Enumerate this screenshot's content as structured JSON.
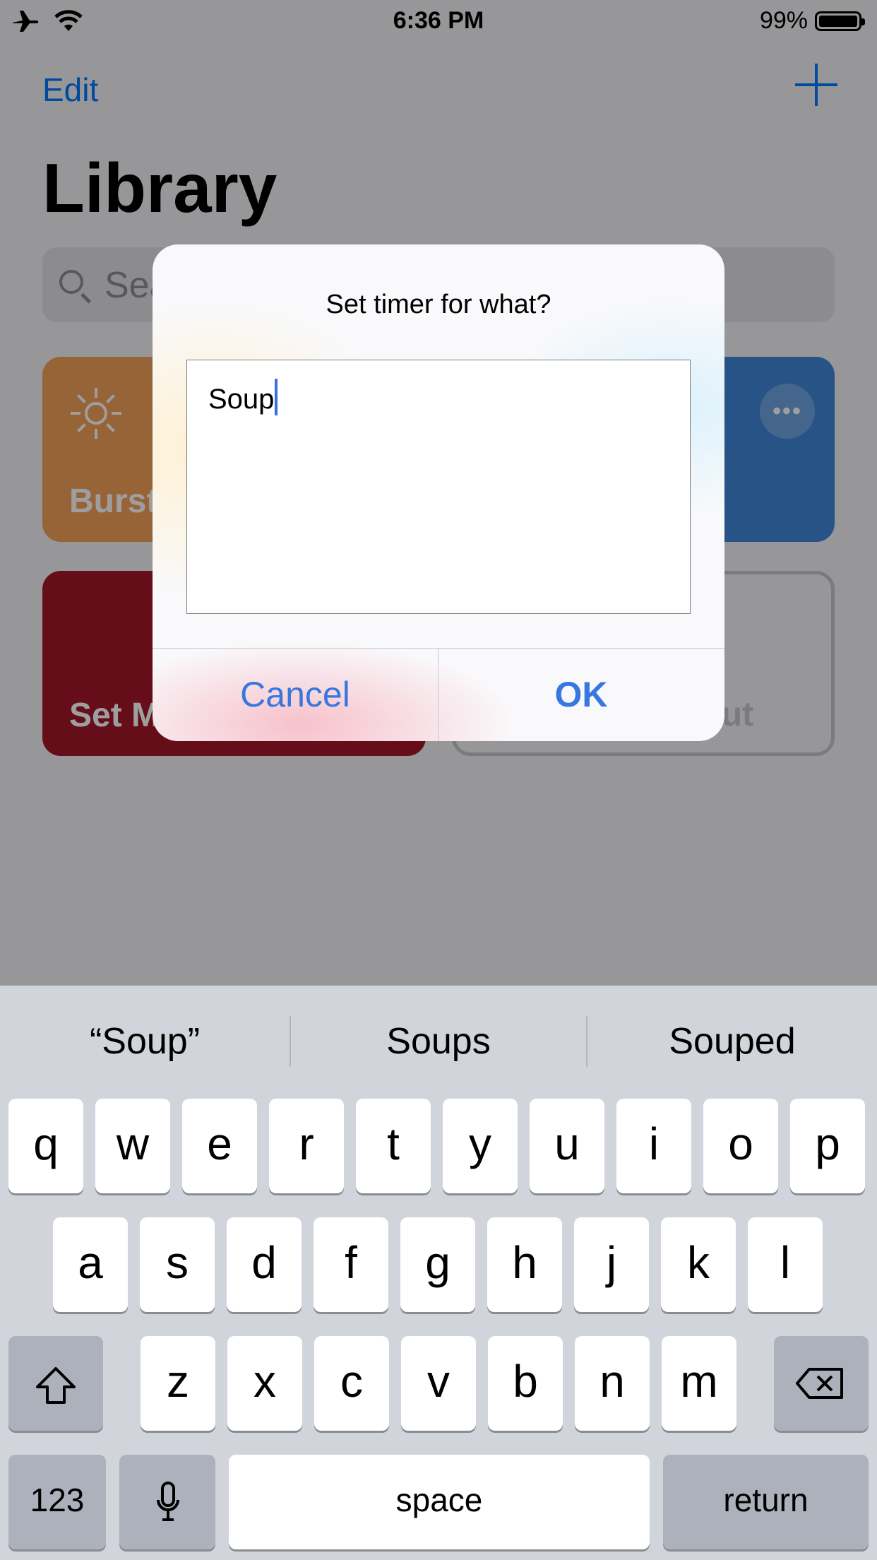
{
  "status": {
    "time": "6:36 PM",
    "battery": "99%",
    "icons": [
      "airplane-icon",
      "wifi-icon",
      "battery-icon"
    ]
  },
  "nav": {
    "edit": "Edit",
    "add_icon": "plus-icon"
  },
  "library": {
    "title": "Library",
    "search_placeholder": "Sea",
    "cards": [
      {
        "label": "Burst",
        "color": "#f2a25a",
        "icon": "sun-icon"
      },
      {
        "label": "",
        "color": "#3f86d8",
        "icon": "more-icon"
      },
      {
        "label": "Set M",
        "color": "#a3182a"
      },
      {
        "label": "ut",
        "color": "#c7c7cc"
      }
    ]
  },
  "alert": {
    "title": "Set timer for what?",
    "input_value": "Soup",
    "cancel": "Cancel",
    "ok": "OK",
    "accent": "#3777e0"
  },
  "keyboard": {
    "suggestions": [
      "“Soup”",
      "Soups",
      "Souped"
    ],
    "row1": [
      "q",
      "w",
      "e",
      "r",
      "t",
      "y",
      "u",
      "i",
      "o",
      "p"
    ],
    "row2": [
      "a",
      "s",
      "d",
      "f",
      "g",
      "h",
      "j",
      "k",
      "l"
    ],
    "row3": [
      "z",
      "x",
      "c",
      "v",
      "b",
      "n",
      "m"
    ],
    "numbers": "123",
    "space": "space",
    "return": "return"
  }
}
